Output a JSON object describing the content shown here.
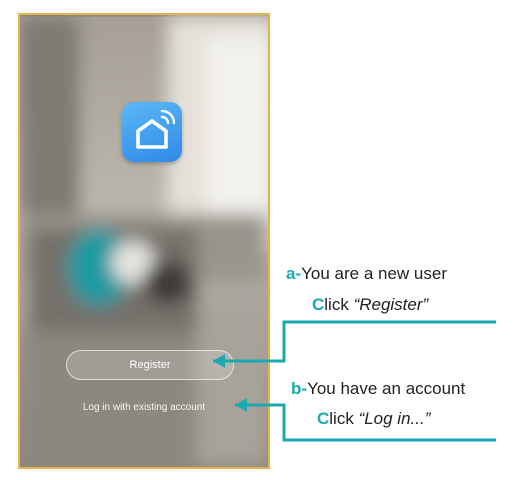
{
  "app": {
    "icon": "smart-home-wifi-icon",
    "register_label": "Register",
    "login_label": "Log in with existing account"
  },
  "annotations": {
    "a_key": "a",
    "a_dash": "-",
    "a_text": "You are a new user",
    "a_click_c": "C",
    "a_click_rest": "lick ",
    "a_click_target": "“Register”",
    "b_key": "b",
    "b_dash": "-",
    "b_text": "You have an account",
    "b_click_c": "C",
    "b_click_rest": "lick ",
    "b_click_target": "“Log in...”"
  },
  "colors": {
    "accent": "#1aa9b0",
    "frame": "#e6b24c",
    "icon_blue": "#2e8ae6"
  }
}
